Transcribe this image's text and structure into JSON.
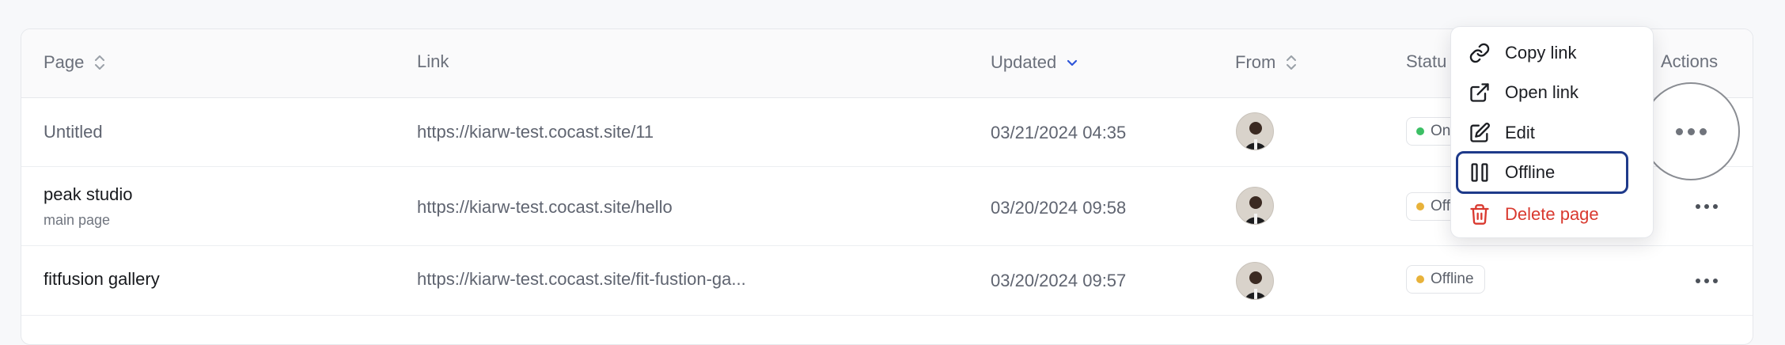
{
  "table": {
    "headers": {
      "page": "Page",
      "link": "Link",
      "updated": "Updated",
      "from": "From",
      "status": "Statu",
      "actions": "Actions"
    },
    "rows": [
      {
        "title": "Untitled",
        "subtitle": "",
        "link": "https://kiarw-test.cocast.site/11",
        "updated": "03/21/2024 04:35",
        "status": "On",
        "status_color": "#3cbf65"
      },
      {
        "title": "peak studio",
        "subtitle": "main page",
        "link": "https://kiarw-test.cocast.site/hello",
        "updated": "03/20/2024 09:58",
        "status": "Off",
        "status_color": "#e8b23a"
      },
      {
        "title": "fitfusion gallery",
        "subtitle": "",
        "link": "https://kiarw-test.cocast.site/fit-fustion-ga...",
        "updated": "03/20/2024 09:57",
        "status": "Offline",
        "status_color": "#e8b23a"
      }
    ]
  },
  "menu": {
    "items": [
      {
        "label": "Copy link",
        "icon": "link-icon"
      },
      {
        "label": "Open link",
        "icon": "external-link-icon"
      },
      {
        "label": "Edit",
        "icon": "edit-icon"
      },
      {
        "label": "Offline",
        "icon": "pause-icon"
      },
      {
        "label": "Delete page",
        "icon": "trash-icon"
      }
    ]
  },
  "colors": {
    "focus_ring": "#1e3a8a",
    "danger": "#d9392f",
    "accent_sort": "#2f56d8"
  }
}
